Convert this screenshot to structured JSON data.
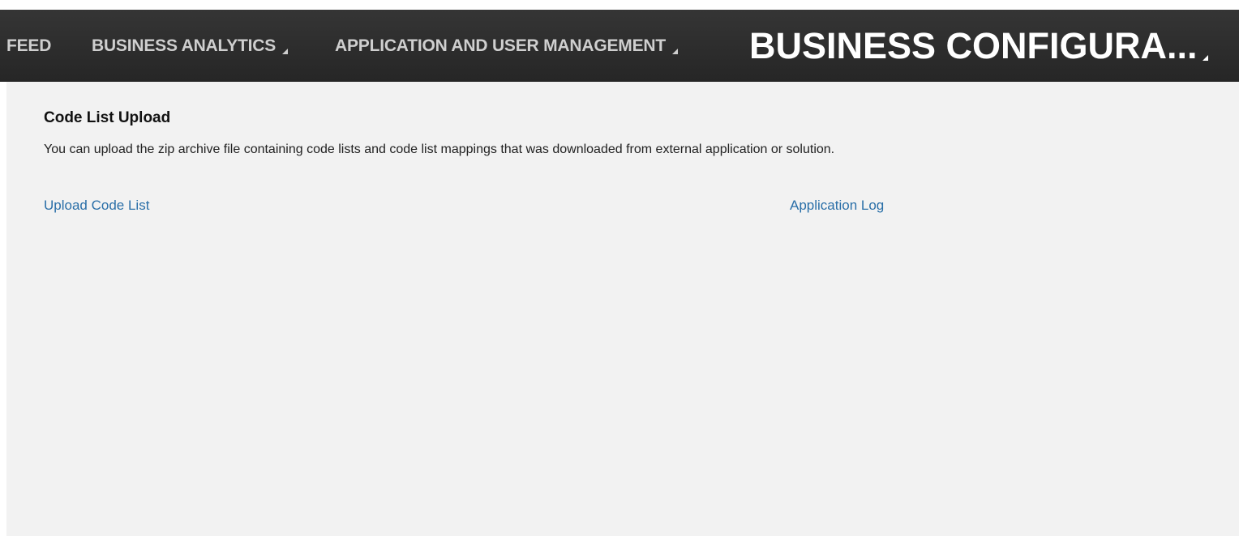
{
  "nav": {
    "items": [
      {
        "label": "FEED"
      },
      {
        "label": "BUSINESS ANALYTICS"
      },
      {
        "label": "APPLICATION AND USER MANAGEMENT"
      },
      {
        "label": "BUSINESS CONFIGURA...",
        "active": true
      }
    ]
  },
  "main": {
    "title": "Code List Upload",
    "description": "You can upload the zip archive file containing code lists and code list mappings that was downloaded from external application or solution.",
    "links": {
      "upload_code_list": "Upload Code List",
      "application_log": "Application Log"
    }
  },
  "colors": {
    "nav_background": "#2e2e2e",
    "nav_text": "#cfcfcf",
    "nav_active_text": "#ffffff",
    "content_background": "#f2f2f2",
    "link": "#2a6fa8"
  }
}
